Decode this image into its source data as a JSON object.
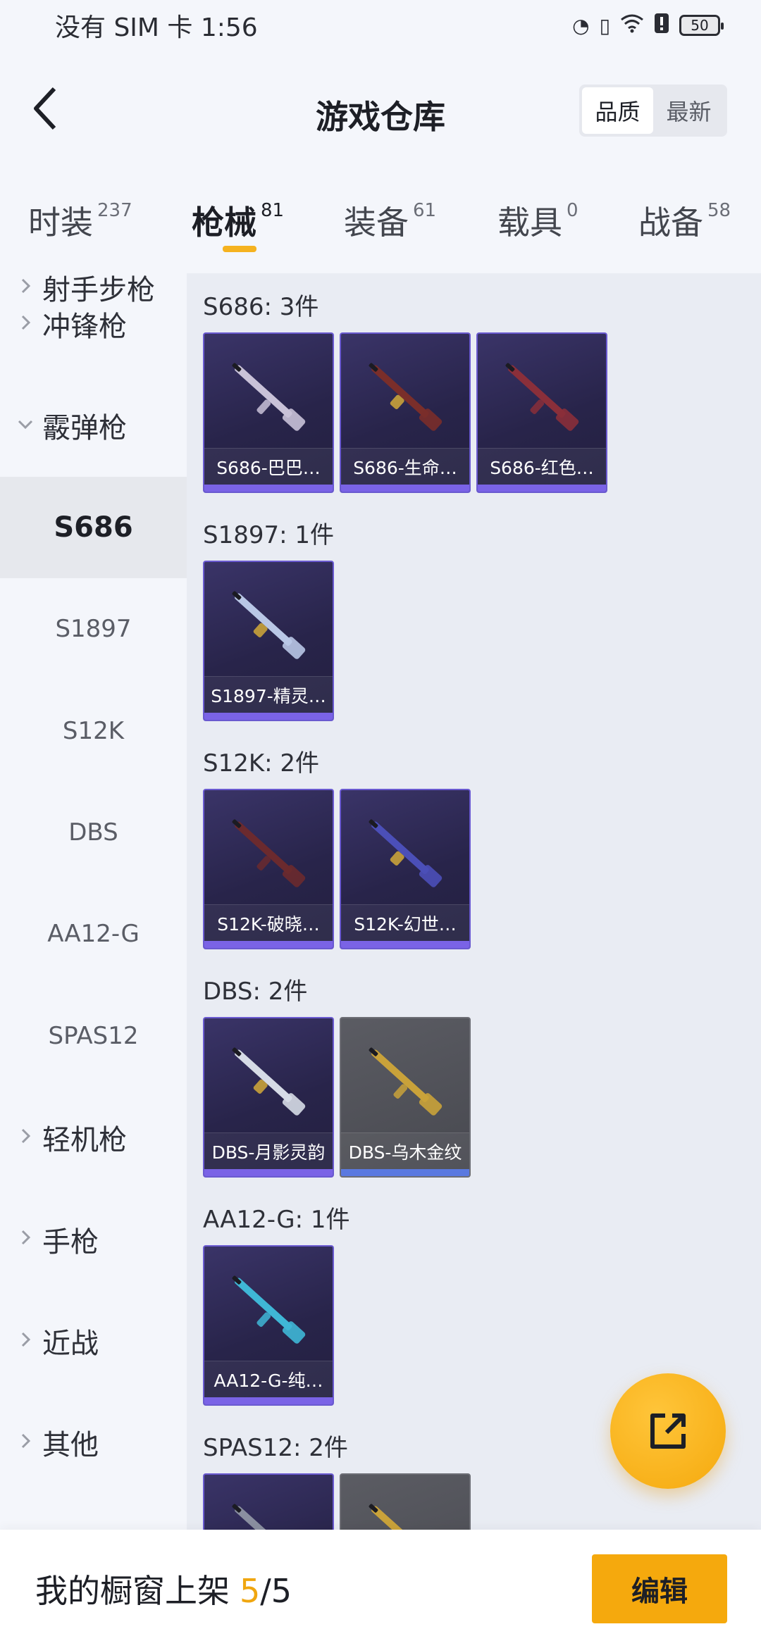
{
  "status_bar": {
    "carrier_time": "没有 SIM 卡 1:56",
    "battery": "50",
    "icons": [
      "data-saver-icon",
      "vibrate-icon",
      "wifi-icon",
      "alert-icon",
      "battery-icon"
    ]
  },
  "header": {
    "title": "游戏仓库",
    "sort_options": [
      "品质",
      "最新"
    ],
    "sort_selected": "品质"
  },
  "tabs": [
    {
      "label": "时装",
      "count": "237"
    },
    {
      "label": "枪械",
      "count": "81",
      "active": true
    },
    {
      "label": "装备",
      "count": "61"
    },
    {
      "label": "载具",
      "count": "0"
    },
    {
      "label": "战备",
      "count": "58"
    }
  ],
  "sidebar": {
    "partial_label": "射手步枪",
    "items": [
      {
        "label": "冲锋枪",
        "type": "group"
      },
      {
        "label": "霰弹枪",
        "type": "group-expanded"
      },
      {
        "label": "S686",
        "type": "sub",
        "selected": true
      },
      {
        "label": "S1897",
        "type": "sub"
      },
      {
        "label": "S12K",
        "type": "sub"
      },
      {
        "label": "DBS",
        "type": "sub"
      },
      {
        "label": "AA12-G",
        "type": "sub"
      },
      {
        "label": "SPAS12",
        "type": "sub"
      },
      {
        "label": "轻机枪",
        "type": "group"
      },
      {
        "label": "手枪",
        "type": "group"
      },
      {
        "label": "近战",
        "type": "group"
      },
      {
        "label": "其他",
        "type": "group"
      }
    ]
  },
  "sections": [
    {
      "title": "S686: 3件",
      "cards": [
        {
          "label": "S686-巴巴…",
          "style": "purple",
          "color": "#c9c2d8"
        },
        {
          "label": "S686-生命…",
          "style": "purple",
          "color": "#7a2e2a"
        },
        {
          "label": "S686-红色…",
          "style": "purple",
          "color": "#8a2f3a"
        }
      ]
    },
    {
      "title": "S1897: 1件",
      "cards": [
        {
          "label": "S1897-精灵…",
          "style": "purple",
          "color": "#b9c7e6"
        }
      ]
    },
    {
      "title": "S12K: 2件",
      "cards": [
        {
          "label": "S12K-破晓…",
          "style": "purple",
          "color": "#6b2a2e"
        },
        {
          "label": "S12K-幻世…",
          "style": "purple",
          "color": "#4b4fb8"
        }
      ]
    },
    {
      "title": "DBS: 2件",
      "cards": [
        {
          "label": "DBS-月影灵韵",
          "style": "purple",
          "color": "#d6dbe6"
        },
        {
          "label": "DBS-乌木金纹",
          "style": "grey",
          "color": "#c9a23a"
        }
      ]
    },
    {
      "title": "AA12-G: 1件",
      "cards": [
        {
          "label": "AA12-G-纯…",
          "style": "purple",
          "color": "#3fb7d6"
        }
      ]
    },
    {
      "title": "SPAS12: 2件",
      "cards": [
        {
          "label": "",
          "style": "purple",
          "color": "#8a8fa0"
        },
        {
          "label": "",
          "style": "grey",
          "color": "#c9a23a"
        }
      ]
    }
  ],
  "fab": {
    "icon": "share-icon"
  },
  "bottom_bar": {
    "label": "我的橱窗上架",
    "count_current": "5",
    "count_sep": "/5",
    "edit_label": "编辑"
  },
  "colors": {
    "accent": "#f5a90d",
    "tab_underline": "#f5b21f",
    "card_purple": "#2c2752",
    "card_grey": "#505157"
  }
}
